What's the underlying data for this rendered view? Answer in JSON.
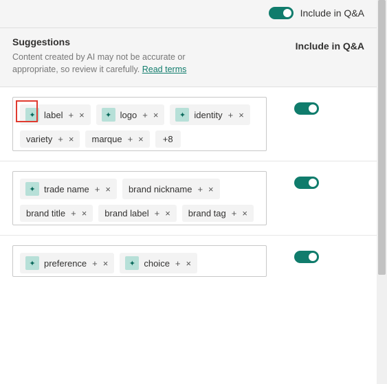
{
  "topBar": {
    "toggleLabel": "Include in Q&A"
  },
  "header": {
    "title": "Suggestions",
    "desc": "Content created by AI may not be accurate or appropriate, so review it carefully. ",
    "readTerms": "Read terms",
    "columnLabel": "Include in Q&A"
  },
  "overflow": "+8",
  "groups": [
    {
      "chips": [
        {
          "ai": true,
          "label": "label",
          "highlighted": true
        },
        {
          "ai": true,
          "label": "logo"
        },
        {
          "ai": true,
          "label": "identity"
        },
        {
          "ai": false,
          "label": "variety"
        },
        {
          "ai": false,
          "label": "marque"
        }
      ],
      "overflow": "+8",
      "include": true
    },
    {
      "chips": [
        {
          "ai": true,
          "label": "trade name"
        },
        {
          "ai": false,
          "label": "brand nickname"
        },
        {
          "ai": false,
          "label": "brand title"
        },
        {
          "ai": false,
          "label": "brand label"
        },
        {
          "ai": false,
          "label": "brand tag"
        }
      ],
      "include": true
    },
    {
      "chips": [
        {
          "ai": true,
          "label": "preference"
        },
        {
          "ai": true,
          "label": "choice"
        }
      ],
      "include": true
    }
  ],
  "icons": {
    "sparkle": "✦",
    "plus": "+",
    "close": "×"
  }
}
